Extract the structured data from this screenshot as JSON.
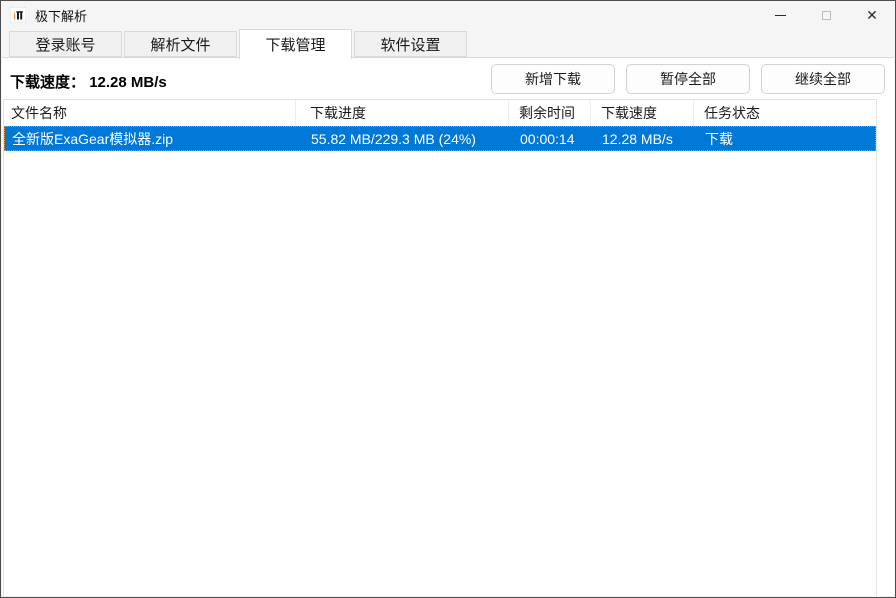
{
  "window": {
    "title": "极下解析",
    "controls": {
      "minimize": "minimize-icon",
      "maximize": "maximize-icon",
      "close": "✕"
    }
  },
  "tabs": [
    {
      "label": "登录账号",
      "active": false
    },
    {
      "label": "解析文件",
      "active": false
    },
    {
      "label": "下载管理",
      "active": true
    },
    {
      "label": "软件设置",
      "active": false
    }
  ],
  "toolbar": {
    "speed_label": "下载速度：",
    "speed_value": "12.28 MB/s",
    "new_download": "新增下载",
    "pause_all": "暂停全部",
    "resume_all": "继续全部"
  },
  "table": {
    "columns": [
      "文件名称",
      "下载进度",
      "剩余时间",
      "下载速度",
      "任务状态"
    ],
    "rows": [
      {
        "name": "全新版ExaGear模拟器.zip",
        "progress": "55.82 MB/229.3 MB (24%)",
        "remaining": "00:00:14",
        "speed": "12.28 MB/s",
        "status": "下载"
      }
    ]
  },
  "colors": {
    "selection_blue": "#0078d7",
    "focus_dotted_orange": "#e2943d",
    "titlebar_bg": "#f5f5f5"
  }
}
